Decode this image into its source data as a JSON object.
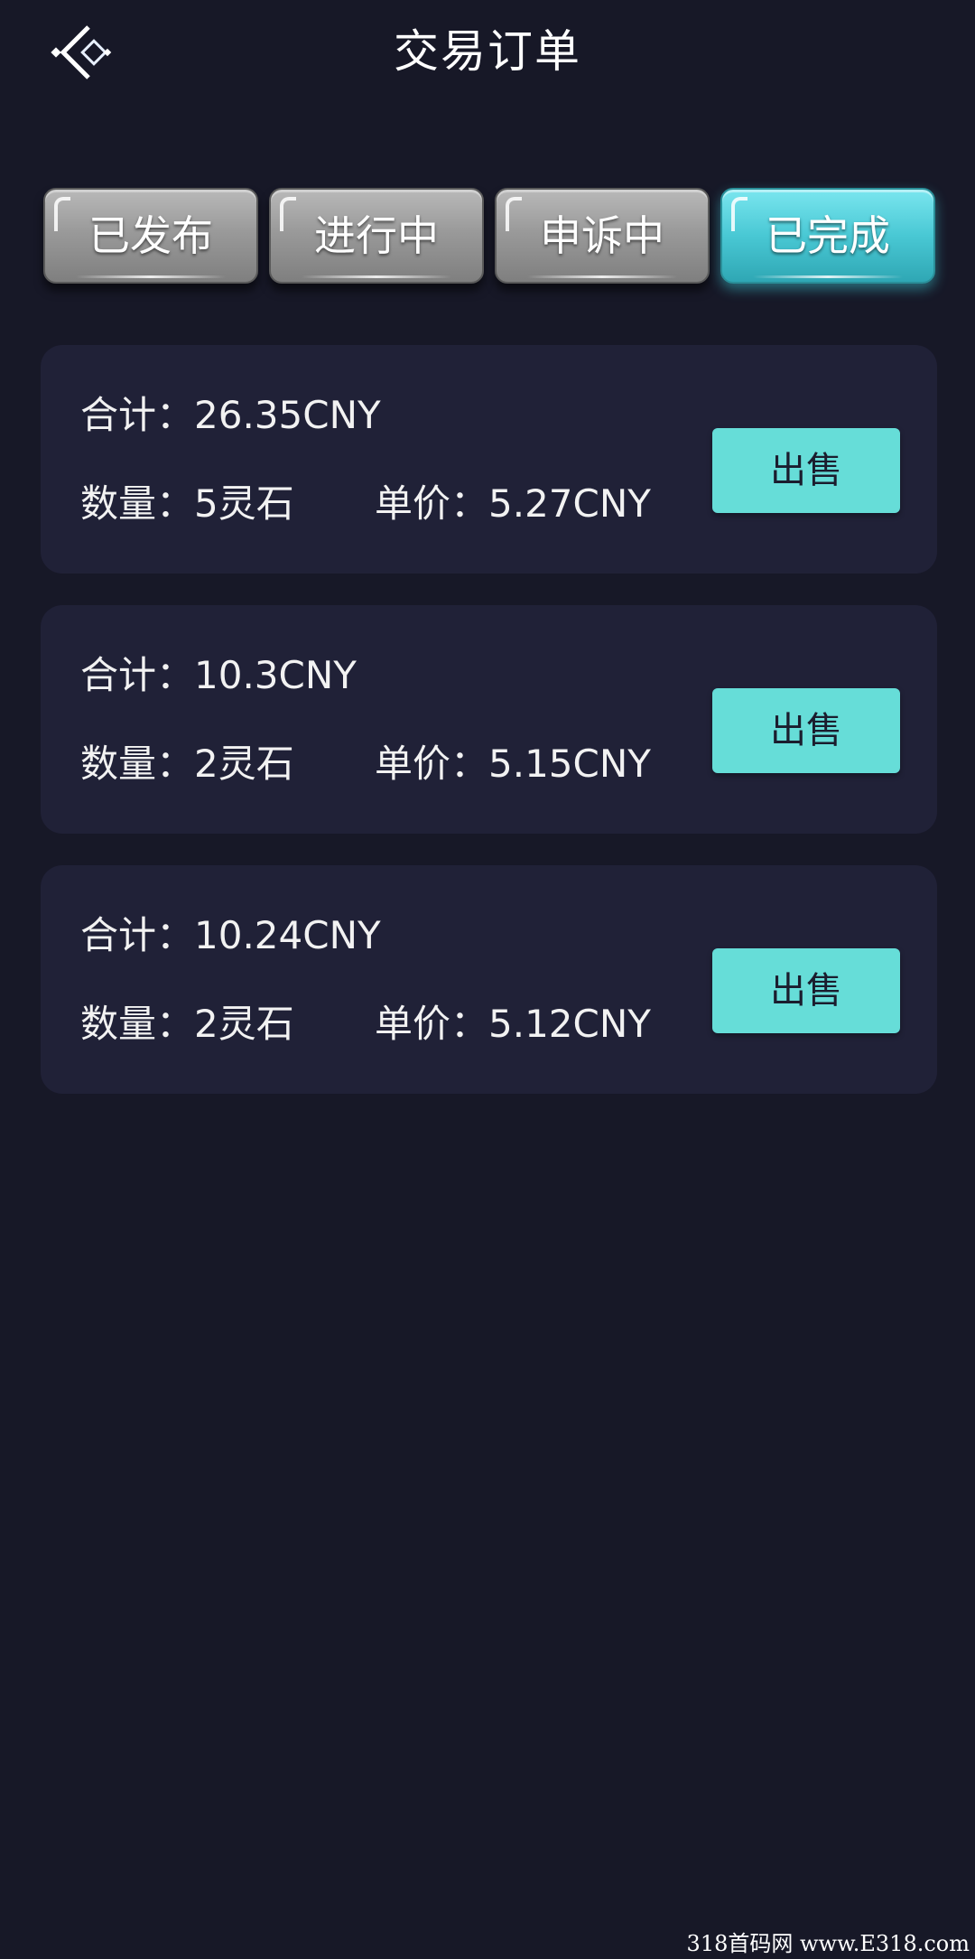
{
  "header": {
    "back_icon": "back-arrow-icon",
    "title": "交易订单"
  },
  "tabs": [
    {
      "label": "已发布",
      "active": false
    },
    {
      "label": "进行中",
      "active": false
    },
    {
      "label": "申诉中",
      "active": false
    },
    {
      "label": "已完成",
      "active": true
    }
  ],
  "orders": [
    {
      "total": "合计：26.35CNY",
      "quantity": "数量：5灵石",
      "unit_price": "单价：5.27CNY",
      "action_label": "出售"
    },
    {
      "total": "合计：10.3CNY",
      "quantity": "数量：2灵石",
      "unit_price": "单价：5.15CNY",
      "action_label": "出售"
    },
    {
      "total": "合计：10.24CNY",
      "quantity": "数量：2灵石",
      "unit_price": "单价：5.12CNY",
      "action_label": "出售"
    }
  ],
  "colors": {
    "background": "#171827",
    "card": "#202137",
    "accent": "#66ddd8",
    "active_tab": "#49c8d4",
    "inactive_tab": "#9a9a9a"
  },
  "watermark": "318首码网 www.E318.com"
}
